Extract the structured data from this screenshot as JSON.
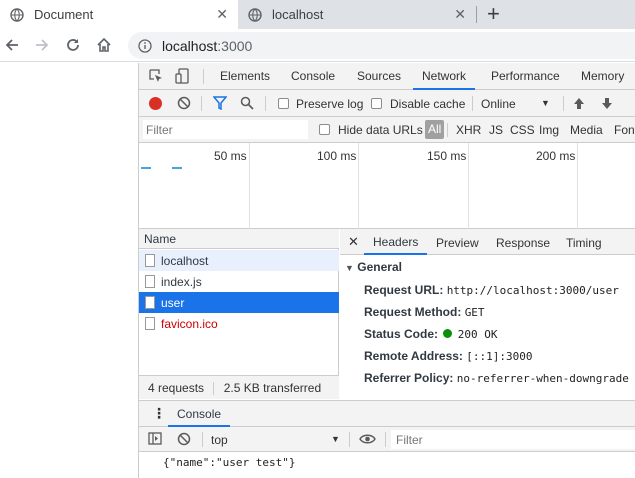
{
  "browser": {
    "tabs": [
      {
        "title": "Document",
        "active": true
      },
      {
        "title": "localhost",
        "active": false
      }
    ],
    "new_tab": "+",
    "close_glyph": "✕",
    "url_host": "localhost",
    "url_port": ":3000"
  },
  "devtools": {
    "panels": [
      "Elements",
      "Console",
      "Sources",
      "Network",
      "Performance",
      "Memory"
    ],
    "selected_panel": "Network",
    "network_toolbar": {
      "preserve_log": "Preserve log",
      "disable_cache": "Disable cache",
      "throttle": "Online"
    },
    "filter": {
      "placeholder": "Filter",
      "hide_data_urls": "Hide data URLs",
      "types": [
        "All",
        "XHR",
        "JS",
        "CSS",
        "Img",
        "Media",
        "Font"
      ]
    },
    "timeline_ticks": [
      "50 ms",
      "100 ms",
      "150 ms",
      "200 ms"
    ],
    "requests": {
      "header": "Name",
      "items": [
        {
          "name": "localhost",
          "state": "hover"
        },
        {
          "name": "index.js",
          "state": "normal"
        },
        {
          "name": "user",
          "state": "selected"
        },
        {
          "name": "favicon.ico",
          "state": "error"
        }
      ],
      "count": "4 requests",
      "transferred": "2.5 KB transferred"
    },
    "detail": {
      "close": "✕",
      "tabs": [
        "Headers",
        "Preview",
        "Response",
        "Timing"
      ],
      "selected_tab": "Headers",
      "section": "General",
      "rows": [
        {
          "key": "Request URL:",
          "value": "http://localhost:3000/user"
        },
        {
          "key": "Request Method:",
          "value": "GET"
        },
        {
          "key": "Status Code:",
          "value": "200 OK"
        },
        {
          "key": "Remote Address:",
          "value": "[::1]:3000"
        },
        {
          "key": "Referrer Policy:",
          "value": "no-referrer-when-downgrade"
        }
      ]
    },
    "console": {
      "tab": "Console",
      "context": "top",
      "filter_placeholder": "Filter",
      "output": "{\"name\":\"user test\"}"
    },
    "colors": {
      "accent": "#1a73e8",
      "record": "#d93025",
      "status_ok": "#0a8f08",
      "error_text": "#c00000"
    }
  }
}
